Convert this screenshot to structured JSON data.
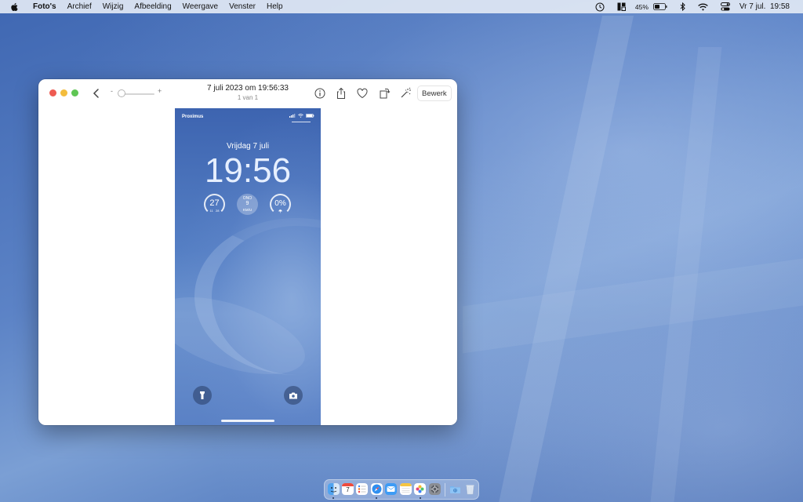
{
  "menubar": {
    "app_name": "Foto's",
    "menus": [
      "Archief",
      "Wijzig",
      "Afbeelding",
      "Weergave",
      "Venster",
      "Help"
    ],
    "battery_percent": "45%",
    "clock": "Vr 7 jul.  19:58",
    "status_icons": [
      "time-machine-icon",
      "stage-manager-icon",
      "battery-icon",
      "bluetooth-icon",
      "wifi-icon",
      "control-center-icon"
    ]
  },
  "window": {
    "title": "7 juli 2023 om 19:56:33",
    "subtitle": "1 van 1",
    "zoom_minus": "-",
    "zoom_plus": "+",
    "zoom_level": 0.1,
    "edit_label": "Bewerk",
    "toolbar_icons": [
      "info-icon",
      "share-icon",
      "heart-icon",
      "rotate-icon",
      "magic-wand-icon"
    ]
  },
  "phone": {
    "carrier": "Proximus",
    "date": "Vrijdag 7 juli",
    "time": "19:56",
    "temp_widget": {
      "value": "27",
      "min": "11",
      "max": "28"
    },
    "wind_widget": {
      "direction": "ONO",
      "speed": "9",
      "unit": "KM/U"
    },
    "rain_widget": {
      "value": "0%"
    }
  },
  "dock": {
    "apps": [
      "finder-icon",
      "calendar-icon",
      "reminders-icon",
      "safari-icon",
      "mail-icon",
      "notes-icon",
      "photos-icon",
      "system-settings-icon",
      "downloads-folder-icon",
      "trash-icon"
    ],
    "calendar_day": "7"
  },
  "colors": {
    "accent": "#3f67b2",
    "close": "#ee5b52",
    "minimize": "#f3bd3d",
    "maximize": "#5fc654"
  }
}
